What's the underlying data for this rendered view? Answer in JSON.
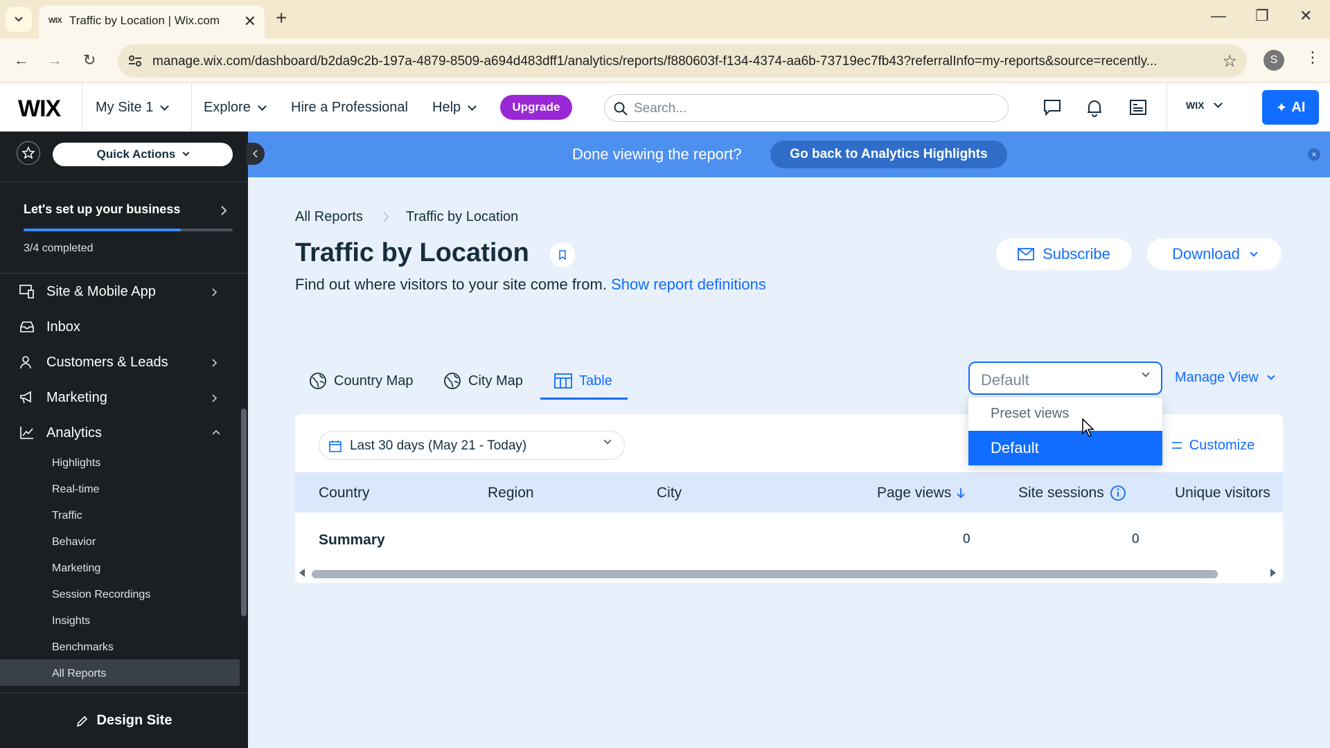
{
  "browser": {
    "tab_title": "Traffic by Location | Wix.com",
    "tab_favicon": "WIX",
    "url": "manage.wix.com/dashboard/b2da9c2b-197a-4879-8509-a694d483dff1/analytics/reports/f880603f-f134-4374-aa6b-73719ec7fb43?referralInfo=my-reports&source=recently...",
    "profile_initial": "S"
  },
  "topbar": {
    "logo": "WIX",
    "site_name": "My Site 1",
    "explore": "Explore",
    "hire": "Hire a Professional",
    "help": "Help",
    "upgrade": "Upgrade",
    "search_placeholder": "Search...",
    "account_logo": "WIX",
    "ai_label": "AI"
  },
  "sidebar": {
    "quick_actions": "Quick Actions",
    "setup_title": "Let's set up your business",
    "setup_status": "3/4 completed",
    "setup_progress": 0.75,
    "items": [
      {
        "label": "Site & Mobile App"
      },
      {
        "label": "Inbox"
      },
      {
        "label": "Customers & Leads"
      },
      {
        "label": "Marketing"
      },
      {
        "label": "Analytics"
      }
    ],
    "analytics_sub": [
      "Highlights",
      "Real-time",
      "Traffic",
      "Behavior",
      "Marketing",
      "Session Recordings",
      "Insights",
      "Benchmarks",
      "All Reports"
    ],
    "design_site": "Design Site"
  },
  "banner": {
    "question": "Done viewing the report?",
    "button": "Go back to Analytics Highlights",
    "close": "×"
  },
  "main": {
    "breadcrumb": [
      "All Reports",
      "Traffic by Location"
    ],
    "title": "Traffic by Location",
    "subtitle": "Find out where visitors to your site come from.",
    "subtitle_link": "Show report definitions",
    "subscribe": "Subscribe",
    "download": "Download",
    "tabs": [
      "Country Map",
      "City Map",
      "Table"
    ],
    "view_select_value": "Default",
    "manage_view": "Manage View",
    "dropdown": {
      "header": "Preset views",
      "option": "Default"
    },
    "date_filter": "Last 30 days (May 21 - Today)",
    "customize": "Customize",
    "columns": [
      "Country",
      "Region",
      "City",
      "Page views",
      "Site sessions",
      "Unique visitors"
    ],
    "summary": {
      "label": "Summary",
      "page_views": "0",
      "site_sessions": "0"
    }
  },
  "colors": {
    "accent": "#116dff",
    "upgrade": "#9a27d5",
    "banner": "#4e90f0",
    "sidebar": "#1b1f24"
  }
}
